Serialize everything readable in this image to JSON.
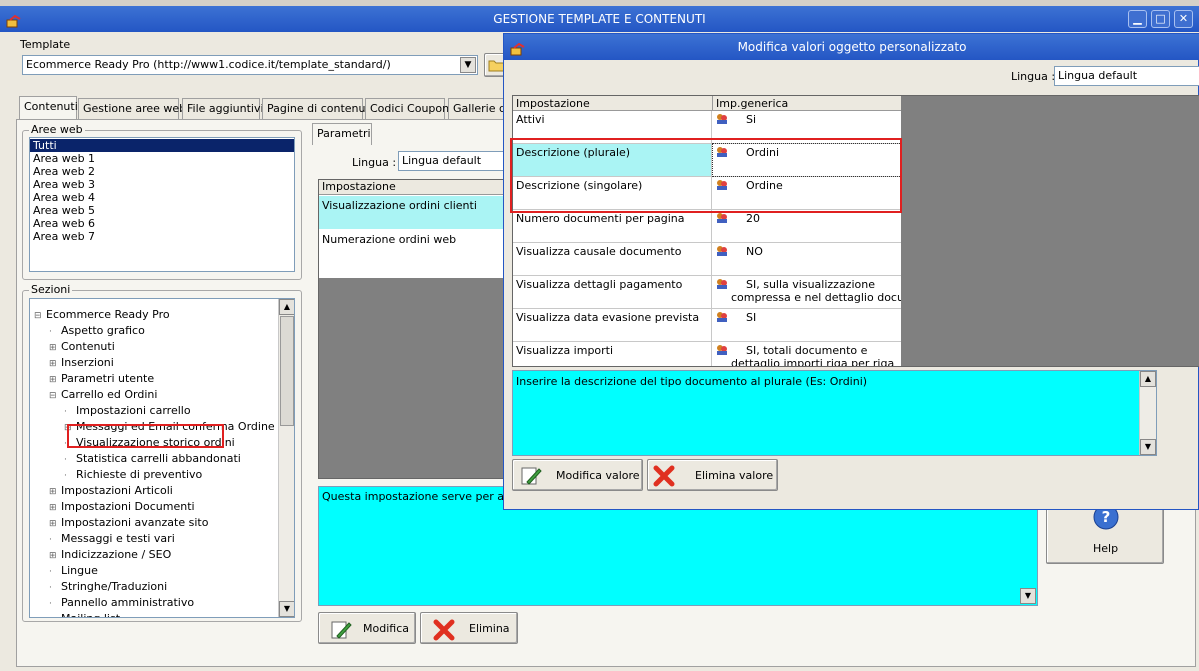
{
  "main_window": {
    "title": "GESTIONE TEMPLATE E CONTENUTI",
    "template_label": "Template",
    "template_value": "Ecommerce Ready Pro (http://www1.codice.it/template_standard/)",
    "tabs": [
      "Contenuti",
      "Gestione aree web",
      "File aggiuntivi",
      "Pagine di contenuti",
      "Codici Coupon",
      "Gallerie di"
    ],
    "aree_web_label": "Aree web",
    "aree_web": [
      "Tutti",
      "Area web 1",
      "Area web 2",
      "Area web 3",
      "Area web 4",
      "Area web 5",
      "Area web 6",
      "Area web 7"
    ],
    "sezioni_label": "Sezioni",
    "tree": [
      {
        "label": "Ecommerce Ready Pro",
        "exp": "⊟"
      },
      {
        "label": "Aspetto grafico",
        "exp": ""
      },
      {
        "label": "Contenuti",
        "exp": "⊞"
      },
      {
        "label": "Inserzioni",
        "exp": "⊞"
      },
      {
        "label": "Parametri utente",
        "exp": "⊞"
      },
      {
        "label": "Carrello ed Ordini",
        "exp": "⊟"
      },
      {
        "label": "Impostazioni carrello",
        "exp": ""
      },
      {
        "label": "Messaggi ed Email conferma Ordine",
        "exp": "⊞"
      },
      {
        "label": "Visualizzazione storico ordini",
        "exp": ""
      },
      {
        "label": "Statistica carrelli abbandonati",
        "exp": ""
      },
      {
        "label": "Richieste di preventivo",
        "exp": ""
      },
      {
        "label": "Impostazioni Articoli",
        "exp": "⊞"
      },
      {
        "label": "Impostazioni Documenti",
        "exp": "⊞"
      },
      {
        "label": "Impostazioni avanzate sito",
        "exp": "⊞"
      },
      {
        "label": "Messaggi e testi vari",
        "exp": ""
      },
      {
        "label": "Indicizzazione / SEO",
        "exp": "⊞"
      },
      {
        "label": "Lingue",
        "exp": ""
      },
      {
        "label": "Stringhe/Traduzioni",
        "exp": ""
      },
      {
        "label": "Pannello amministrativo",
        "exp": ""
      },
      {
        "label": "Mailing list",
        "exp": ""
      }
    ],
    "parametri_tab": "Parametri",
    "lingua_label": "Lingua :",
    "lingua_value": "Lingua default",
    "param_header": "Impostazione",
    "params": [
      "Visualizzazione ordini clienti",
      "Numerazione ordini web"
    ],
    "description": "Questa impostazione serve per attivar",
    "modifica_label": "Modifica",
    "elimina_label": "Elimina",
    "help_label": "Help"
  },
  "dialog": {
    "title": "Modifica valori oggetto personalizzato",
    "lingua_label": "Lingua :",
    "lingua_value": "Lingua default",
    "col_impostazione": "Impostazione",
    "col_generica": "Imp.generica",
    "rows": [
      {
        "name": "Attivi",
        "value": "Si",
        "value2": ""
      },
      {
        "name": "Descrizione (plurale)",
        "value": "Ordini",
        "value2": ""
      },
      {
        "name": "Descrizione (singolare)",
        "value": "Ordine",
        "value2": ""
      },
      {
        "name": "Numero documenti per pagina",
        "value": "20",
        "value2": ""
      },
      {
        "name": "Visualizza causale documento",
        "value": "NO",
        "value2": ""
      },
      {
        "name": "Visualizza dettagli pagamento",
        "value": "SI, sulla visualizzazione",
        "value2": "compressa e nel dettaglio docu..."
      },
      {
        "name": "Visualizza data evasione prevista",
        "value": "SI",
        "value2": ""
      },
      {
        "name": "Visualizza importi",
        "value": "SI, totali documento e",
        "value2": "dettaglio importi riga per riga"
      }
    ],
    "description": "Inserire la descrizione del tipo documento al plurale (Es: Ordini)",
    "modifica_valore": "Modifica valore",
    "elimina_valore": "Elimina valore"
  },
  "colors": {
    "accent_cyan": "#00ffff",
    "highlight_red": "#e02020",
    "selection": "#0a246a"
  }
}
